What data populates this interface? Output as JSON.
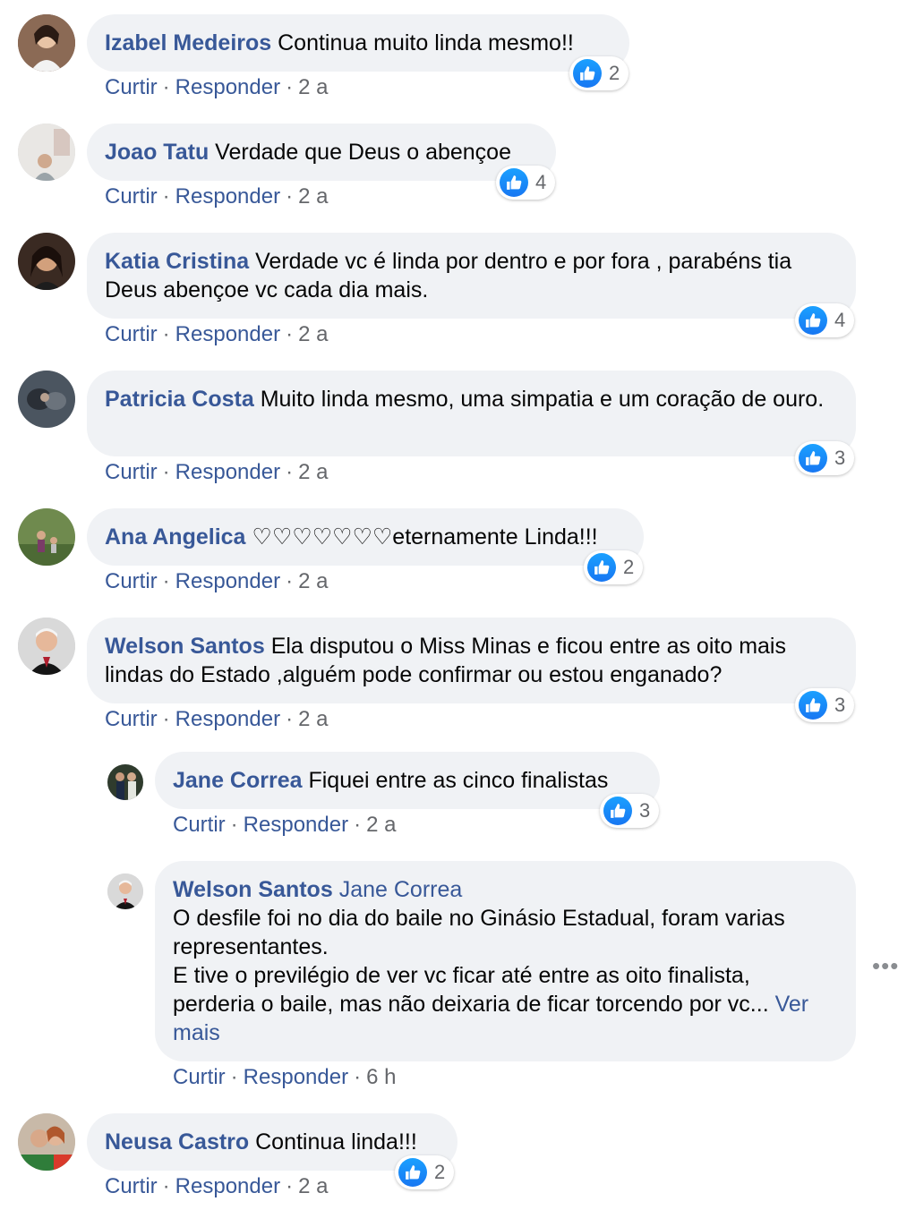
{
  "actions": {
    "like": "Curtir",
    "reply": "Responder",
    "sep": "·"
  },
  "comments": [
    {
      "author": "Izabel Medeiros",
      "text": "Continua muito linda mesmo!!",
      "time": "2 a",
      "likes": "2"
    },
    {
      "author": "Joao Tatu",
      "text": "Verdade que Deus o abençoe",
      "time": "2 a",
      "likes": "4"
    },
    {
      "author": "Katia Cristina",
      "text": "Verdade vc é linda por dentro e por fora , parabéns tia Deus abençoe vc cada dia mais.",
      "time": "2 a",
      "likes": "4"
    },
    {
      "author": "Patricia Costa",
      "text": "Muito linda mesmo, uma simpatia e um coração de ouro.",
      "time": "2 a",
      "likes": "3"
    },
    {
      "author": "Ana Angelica",
      "text": "♡♡♡♡♡♡♡eternamente Linda!!!",
      "time": "2 a",
      "likes": "2"
    },
    {
      "author": "Welson Santos",
      "text": "Ela disputou o Miss Minas e ficou entre as oito mais lindas do Estado ,alguém pode confirmar ou estou enganado?",
      "time": "2 a",
      "likes": "3"
    },
    {
      "author": "Jane Correa",
      "text": "Fiquei entre as cinco finalistas",
      "time": "2 a",
      "likes": "3"
    },
    {
      "author": "Welson Santos",
      "mention": "Jane Correa",
      "line1": "O desfile foi no dia do baile no Ginásio Estadual, foram varias representantes.",
      "line2": "E tive o previlégio de ver vc ficar até entre as oito finalista, perderia o baile, mas não deixaria de ficar torcendo por vc...",
      "see_more": "Ver mais",
      "time": "6 h"
    },
    {
      "author": "Neusa Castro",
      "text": "Continua linda!!!",
      "time": "2 a",
      "likes": "2"
    }
  ],
  "more_options": "•••",
  "colors": {
    "author": "#385898",
    "bubble": "#f0f2f5",
    "like": "#1877f2"
  }
}
